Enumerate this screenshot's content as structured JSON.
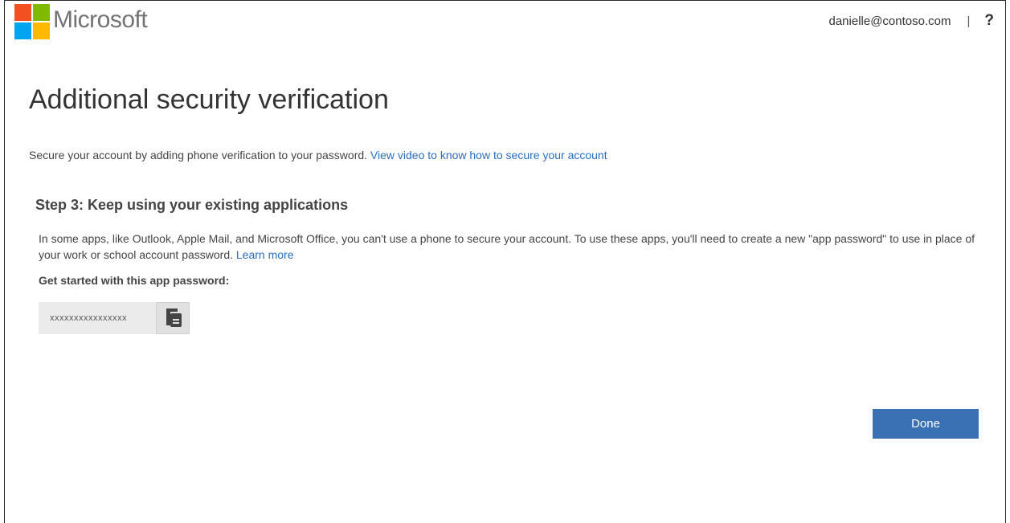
{
  "header": {
    "brand": "Microsoft",
    "user_email": "danielle@contoso.com",
    "divider": "|",
    "help_label": "?"
  },
  "logo_colors": {
    "red": "#f25022",
    "green": "#7fba00",
    "blue": "#00a4ef",
    "yellow": "#ffb900"
  },
  "main": {
    "title": "Additional security verification",
    "intro_text": "Secure your account by adding phone verification to your password.",
    "intro_link": "View video to know how to secure your account",
    "step_title": "Step 3: Keep using your existing applications",
    "step_desc": "In some apps, like Outlook, Apple Mail, and Microsoft Office, you can't use a phone to secure your account. To use these apps, you'll need to create a new \"app password\" to use in place of your work or school account password.",
    "learn_more": "Learn more",
    "app_password_label": "Get started with this app password:",
    "app_password_value": "xxxxxxxxxxxxxxxx",
    "copy_icon": "copy-icon",
    "done_label": "Done"
  },
  "colors": {
    "link": "#2a6ebb",
    "primary_button": "#3a70b4"
  }
}
